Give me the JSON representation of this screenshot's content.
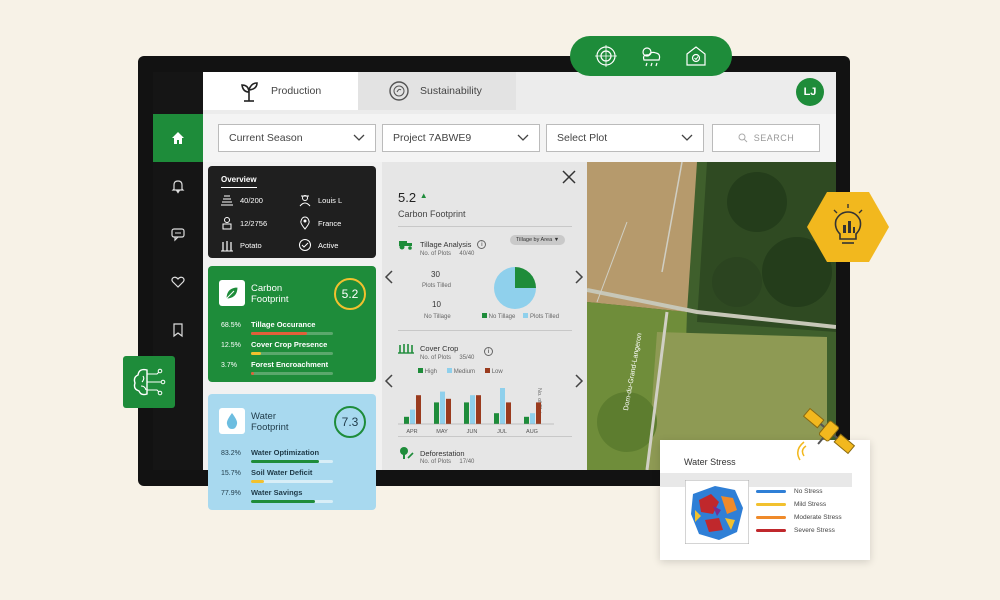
{
  "tabs": [
    {
      "label": "Production",
      "icon": "sprout-icon",
      "active": true
    },
    {
      "label": "Sustainability",
      "icon": "sustainability-icon",
      "active": false
    }
  ],
  "user": {
    "initials": "LJ"
  },
  "filters": {
    "season": "Current Season",
    "project": "Project 7ABWE9",
    "plot": "Select Plot",
    "search_placeholder": "SEARCH"
  },
  "sidebar": {
    "items": [
      {
        "icon": "home-icon",
        "active": true
      },
      {
        "icon": "bell-icon",
        "active": false
      },
      {
        "icon": "chat-icon",
        "active": false
      },
      {
        "icon": "heart-icon",
        "active": false
      },
      {
        "icon": "bookmark-icon",
        "active": false
      }
    ]
  },
  "overview": {
    "title": "Overview",
    "items": [
      {
        "icon": "field-icon",
        "value": "40/200"
      },
      {
        "icon": "farmer-icon",
        "value": "Louis L"
      },
      {
        "icon": "worker-icon",
        "value": "12/2756"
      },
      {
        "icon": "location-icon",
        "value": "France"
      },
      {
        "icon": "crop-icon",
        "value": "Potato"
      },
      {
        "icon": "status-icon",
        "value": "Active"
      }
    ]
  },
  "carbon": {
    "title_line1": "Carbon",
    "title_line2": "Footprint",
    "score": "5.2",
    "metrics": [
      {
        "pct": "68.5%",
        "label": "Tillage Occurance",
        "fill": 0.685,
        "color": "#e0603a"
      },
      {
        "pct": "12.5%",
        "label": "Cover Crop Presence",
        "fill": 0.125,
        "color": "#f2c12e"
      },
      {
        "pct": "3.7%",
        "label": "Forest Encroachment",
        "fill": 0.037,
        "color": "#e0603a"
      }
    ]
  },
  "water": {
    "title_line1": "Water",
    "title_line2": "Footprint",
    "score": "7.3",
    "metrics": [
      {
        "pct": "83.2%",
        "label": "Water Optimization",
        "fill": 0.832,
        "color": "#1e8c3a"
      },
      {
        "pct": "15.7%",
        "label": "Soil Water Deficit",
        "fill": 0.157,
        "color": "#f2c12e"
      },
      {
        "pct": "77.9%",
        "label": "Water Savings",
        "fill": 0.779,
        "color": "#1e8c3a"
      }
    ]
  },
  "detail": {
    "score": "5.2",
    "score_caption": "Carbon Footprint",
    "tillage": {
      "title": "Tillage Analysis",
      "plots_label": "No. of Plots",
      "plots_value": "40/40",
      "dropdown": "Tillage by Area",
      "tilled_count": "30",
      "tilled_label": "Plots Tilled",
      "notill_count": "10",
      "notill_label": "No Tillage",
      "legend": [
        "No Tillage",
        "Plots Tilled"
      ]
    },
    "cover_crop": {
      "title": "Cover Crop",
      "plots_label": "No. of Plots",
      "plots_value": "35/40",
      "legend": [
        "High",
        "Medium",
        "Low"
      ],
      "y_label": "No. of Plots"
    },
    "deforestation": {
      "title": "Deforestation",
      "plots_label": "No. of Plots",
      "plots_value": "17/40"
    }
  },
  "chart_data": [
    {
      "type": "pie",
      "categories": [
        "No Tillage",
        "Plots Tilled"
      ],
      "values": [
        10,
        30
      ],
      "colors": [
        "#1e8c3a",
        "#8fd0ec"
      ]
    },
    {
      "type": "bar",
      "categories": [
        "APR",
        "MAY",
        "JUN",
        "JUL",
        "AUG"
      ],
      "series": [
        {
          "name": "High",
          "values": [
            2,
            6,
            6,
            3,
            2
          ],
          "color": "#1e8c3a"
        },
        {
          "name": "Medium",
          "values": [
            4,
            9,
            8,
            10,
            3
          ],
          "color": "#8fd0ec"
        },
        {
          "name": "Low",
          "values": [
            8,
            7,
            8,
            6,
            6
          ],
          "color": "#9a3b1e"
        }
      ],
      "ylabel": "No. of Plots",
      "ylim": [
        0,
        10
      ],
      "legend": "top"
    }
  ],
  "map": {
    "road_label": "Dom-du-Grand-Langeron"
  },
  "water_stress": {
    "title": "Water Stress",
    "legend": [
      {
        "label": "No Stress",
        "color": "#2f7fd6"
      },
      {
        "label": "Mild Stress",
        "color": "#f2c12e"
      },
      {
        "label": "Moderate Stress",
        "color": "#ef8a2a"
      },
      {
        "label": "Severe Stress",
        "color": "#c0282c"
      }
    ]
  },
  "floating": {
    "top_icons": [
      "target-icon",
      "weather-icon",
      "barn-icon"
    ],
    "brain_icon": "ai-brain-icon",
    "insight_icon": "insight-bulb-icon",
    "satellite_icon": "satellite-icon"
  }
}
